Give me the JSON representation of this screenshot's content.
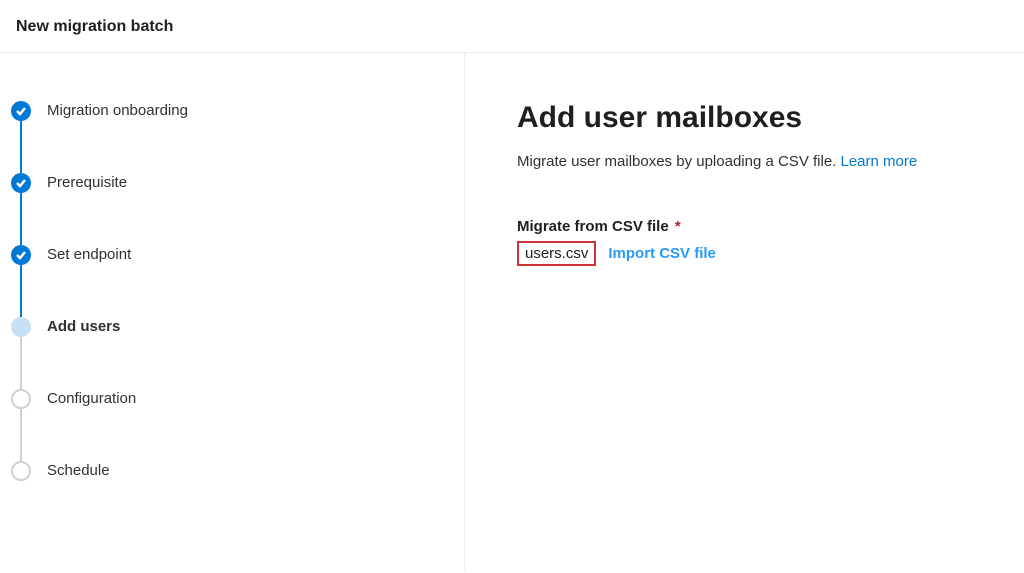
{
  "header": {
    "title": "New migration batch"
  },
  "steps": [
    {
      "label": "Migration onboarding",
      "state": "done"
    },
    {
      "label": "Prerequisite",
      "state": "done"
    },
    {
      "label": "Set endpoint",
      "state": "done"
    },
    {
      "label": "Add users",
      "state": "current"
    },
    {
      "label": "Configuration",
      "state": "pending"
    },
    {
      "label": "Schedule",
      "state": "pending"
    }
  ],
  "main": {
    "heading": "Add user mailboxes",
    "description": "Migrate user mailboxes by uploading a CSV file. ",
    "learn_more": "Learn more",
    "field_label": "Migrate from CSV file",
    "required_mark": "*",
    "file_name": "users.csv",
    "import_label": "Import CSV file"
  }
}
